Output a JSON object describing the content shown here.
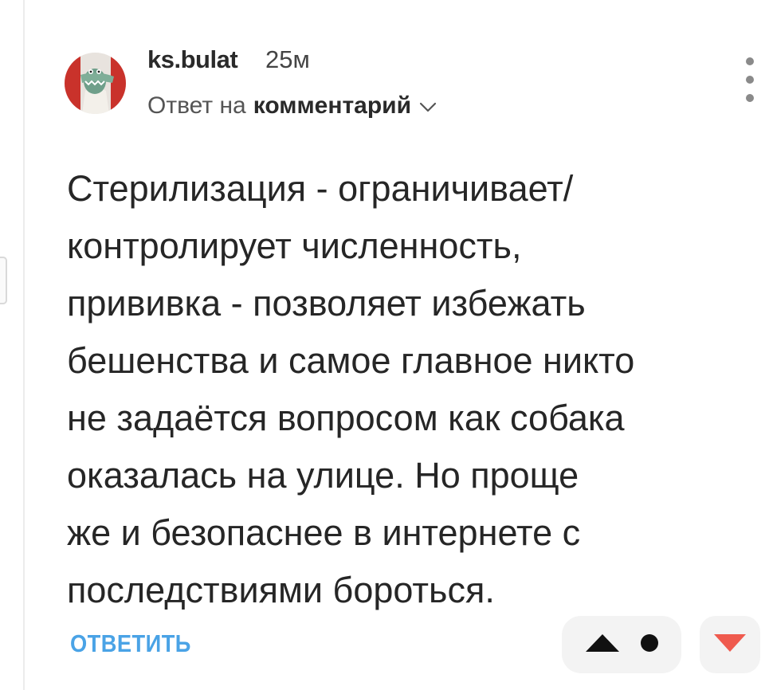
{
  "comment": {
    "author": "ks.bulat",
    "time": "25м",
    "reply_prefix": "Ответ на",
    "reply_target": "комментарий",
    "text_lines": [
      "Стерилизация - ограничивает/",
      "контролирует численность,",
      "прививка - позволяет избежать",
      "бешенства и самое главное никто",
      "не задаётся вопросом как собака",
      "оказалась на улице. Но проще",
      "же и безопаснее в интернете с",
      "последствиями бороться."
    ]
  },
  "actions": {
    "reply_label": "ОТВЕТИТЬ"
  },
  "icons": {
    "avatar": "cartoon-crocodile-avatar",
    "chevron": "chevron-down-icon",
    "more": "more-vertical-icon",
    "upvote": "triangle-up-icon",
    "score": "dot-icon",
    "downvote": "triangle-down-icon"
  },
  "colors": {
    "accent": "#4aa3e6",
    "downvote": "#ef5a4e",
    "pill_bg": "#f3f3f3"
  }
}
